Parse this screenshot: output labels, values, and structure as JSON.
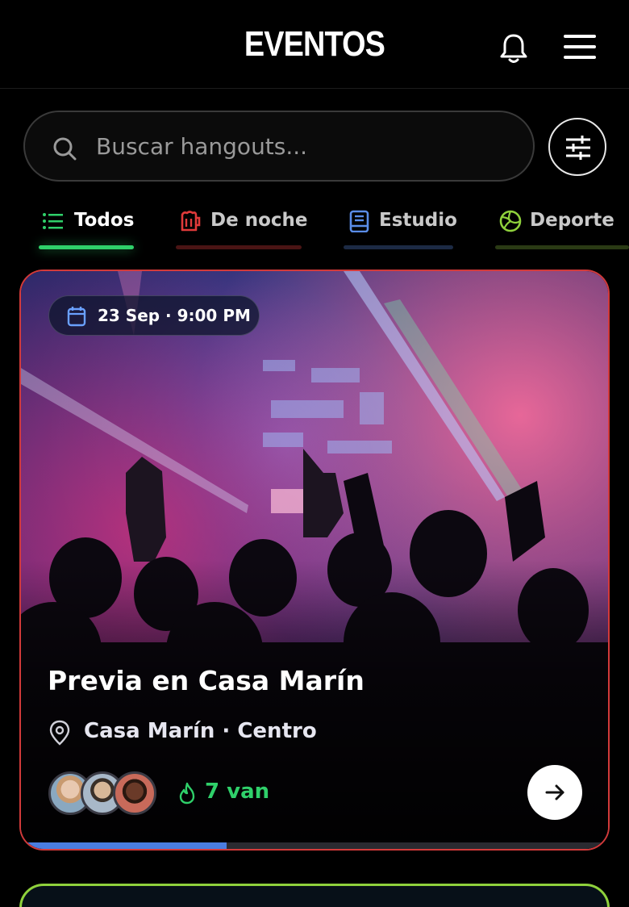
{
  "header": {
    "title": "EVENTOS"
  },
  "search": {
    "placeholder": "Buscar hangouts..."
  },
  "tabs": [
    {
      "label": "Todos",
      "icon": "list-icon",
      "color": "#2fd06a",
      "active": true
    },
    {
      "label": "De noche",
      "icon": "beer-mug-icon",
      "color": "#e03a3a",
      "active": false
    },
    {
      "label": "Estudio",
      "icon": "book-icon",
      "color": "#5a8de8",
      "active": false
    },
    {
      "label": "Deporte",
      "icon": "volleyball-icon",
      "color": "#8fd13c",
      "active": false
    }
  ],
  "event": {
    "date": "23 Sep · 9:00 PM",
    "title": "Previa en Casa Marín",
    "location": "Casa Marín · Centro",
    "going": "7 van",
    "progress": 0.35,
    "border_color": "#d23a3a"
  },
  "colors": {
    "accent_green": "#2fd06a",
    "background": "#000000"
  }
}
